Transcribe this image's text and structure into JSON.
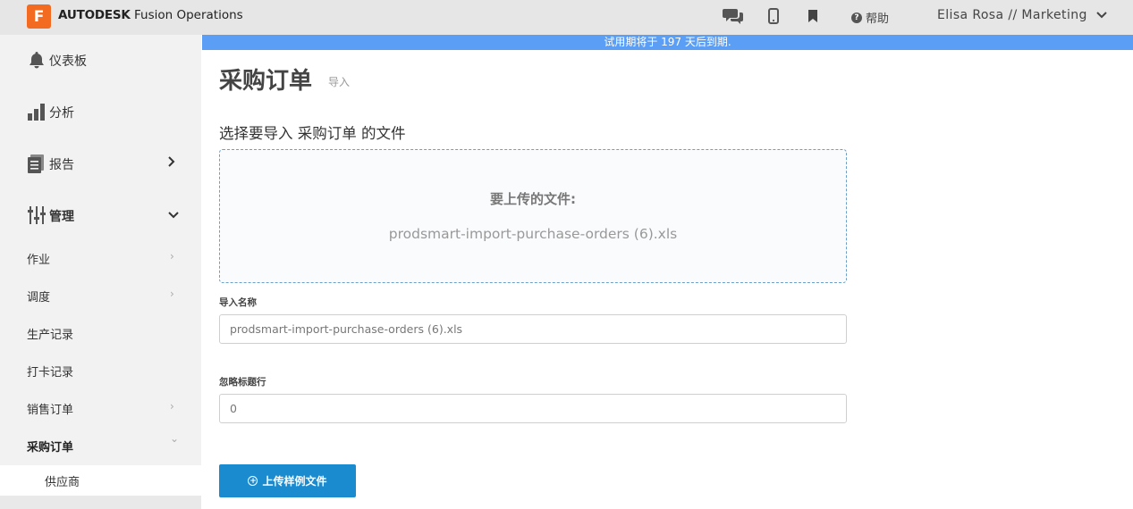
{
  "topbar": {
    "logo_letter": "F",
    "brand_bold": "AUTODESK",
    "brand_rest": " Fusion Operations",
    "help_label": "帮助",
    "user_label": "Elisa Rosa // Marketing",
    "icons": [
      "chat-icon",
      "mobile-icon",
      "bookmark-icon",
      "question-icon",
      "chevron-down-icon"
    ]
  },
  "banner": {
    "text": "试用期将于 197 天后到期."
  },
  "sidebar": {
    "dashboard": "仪表板",
    "analytics": "分析",
    "reports": "报告",
    "manage": "管理",
    "manage_items": [
      {
        "label": "作业",
        "chev": "›"
      },
      {
        "label": "调度",
        "chev": "›"
      },
      {
        "label": "生产记录",
        "chev": ""
      },
      {
        "label": "打卡记录",
        "chev": ""
      },
      {
        "label": "销售订单",
        "chev": "›"
      },
      {
        "label": "采购订单",
        "chev": "⌄"
      }
    ],
    "supplier": "供应商"
  },
  "main": {
    "title": "采购订单",
    "subtitle": "导入",
    "section_title": "选择要导入 采购订单 的文件",
    "dropzone_title": "要上传的文件:",
    "dropzone_file": "prodsmart-import-purchase-orders (6).xls",
    "import_name_label": "导入名称",
    "import_name_value": "prodsmart-import-purchase-orders (6).xls",
    "ignore_rows_label": "忽略标题行",
    "ignore_rows_value": "0",
    "upload_button": "上传样例文件"
  },
  "colors": {
    "topbar_bg": "#e6e6e6",
    "banner_bg": "#5b9ef5",
    "sidebar_bg": "#f2f2f2",
    "logo": "#f26b21",
    "primary_button": "#1b8bd0",
    "dropzone_border": "#6aa0c9"
  }
}
